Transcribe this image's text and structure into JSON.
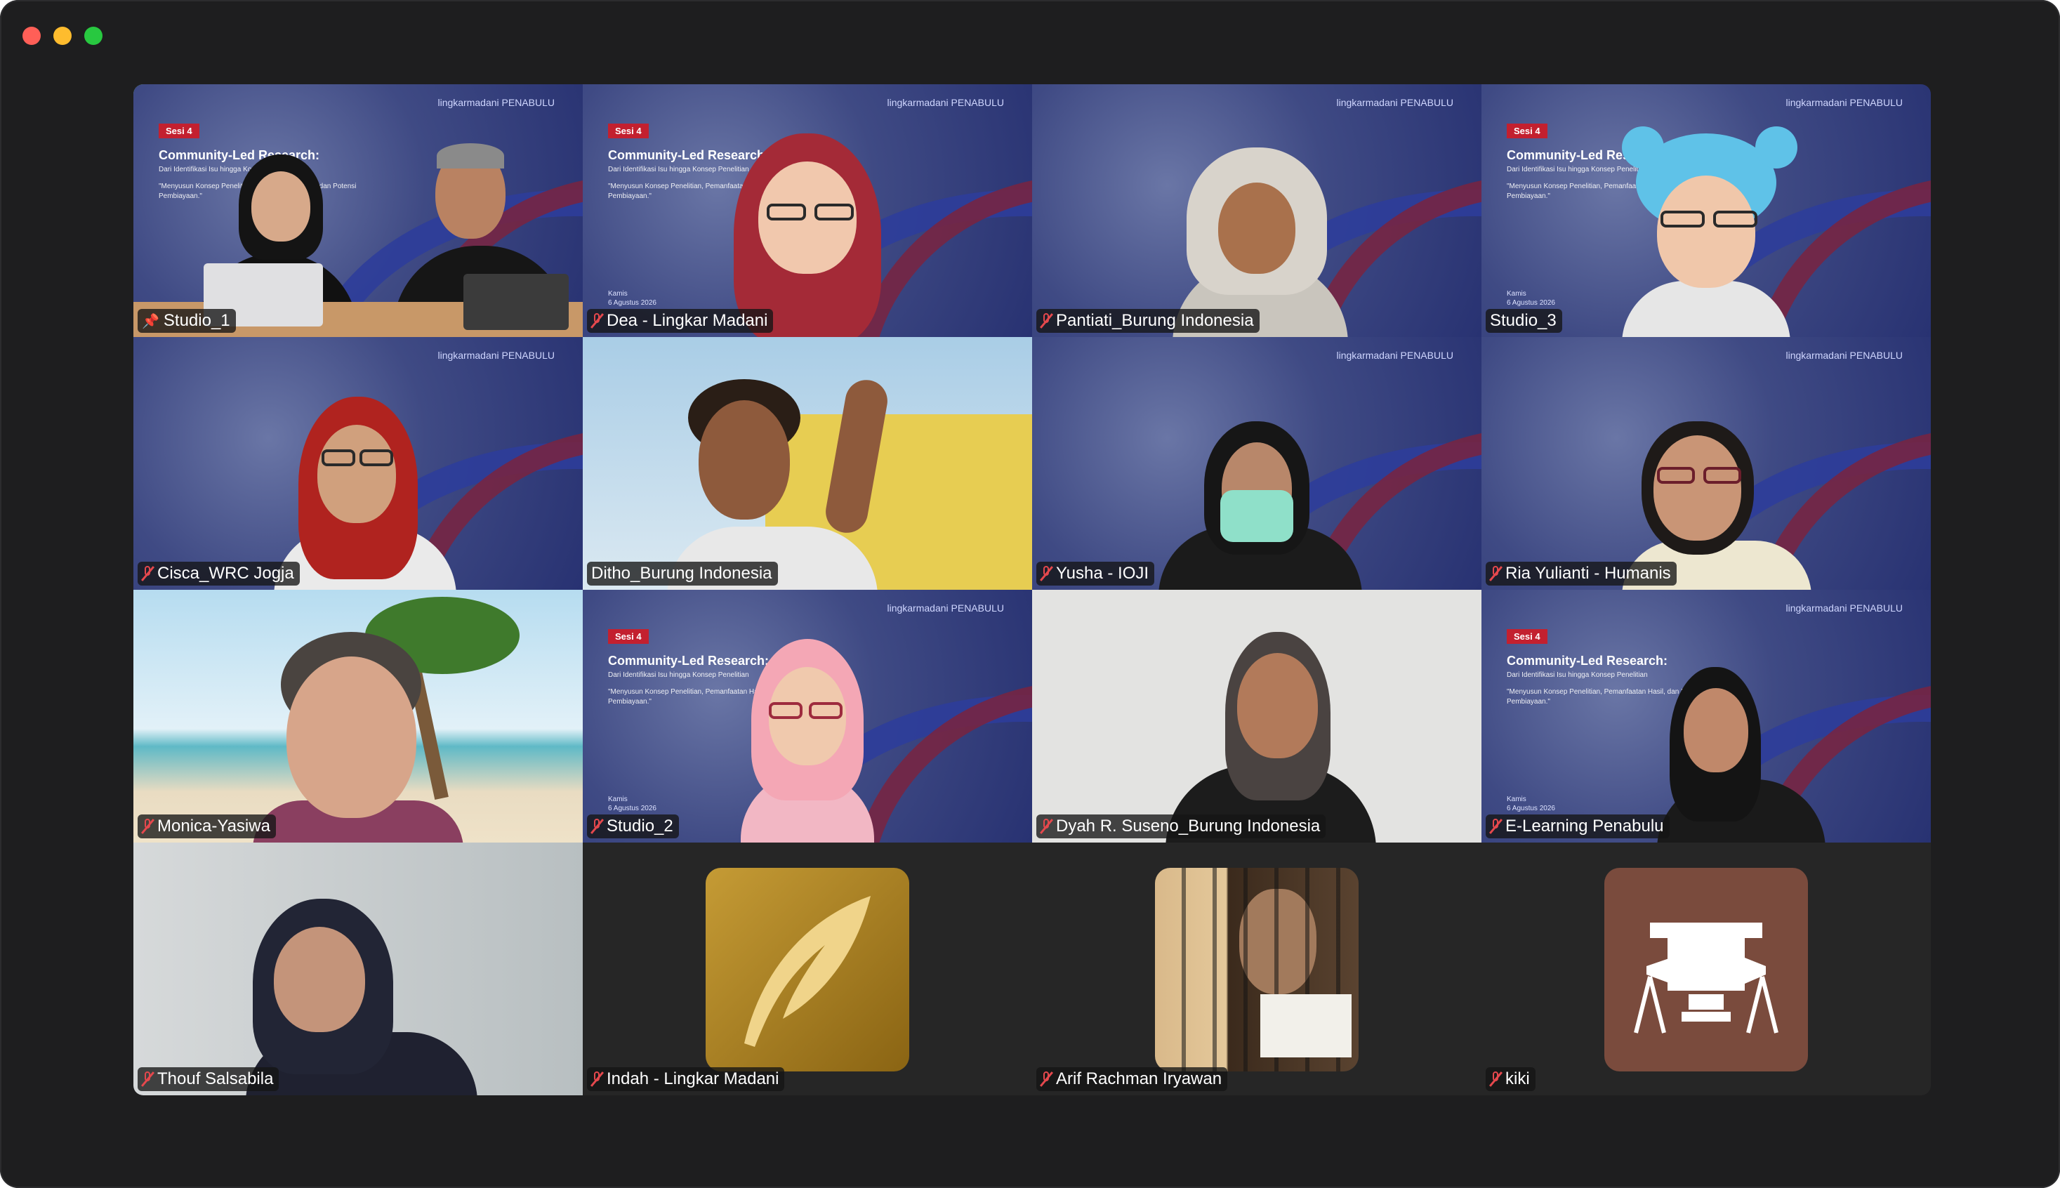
{
  "window": {
    "controls": {
      "close_color": "#ff5f57",
      "minimize_color": "#febc2e",
      "zoom_color": "#28c840"
    }
  },
  "slide": {
    "sesi": "Sesi 4",
    "title": "Community-Led Research:",
    "subtitle": "Dari Identifikasi Isu hingga Konsep Penelitian",
    "quote": "\"Menyusun Konsep Penelitian, Pemanfaatan Hasil, dan Potensi Pembiayaan.\"",
    "day": "Kamis",
    "date": "6 Agustus 2026",
    "logo": "lingkarmadani  PENABULU"
  },
  "participants": [
    {
      "name": "Studio_1",
      "status_icon": "pin-icon",
      "active": true
    },
    {
      "name": "Dea - Lingkar Madani",
      "status_icon": "mic-off-icon"
    },
    {
      "name": "Pantiati_Burung Indonesia",
      "status_icon": "mic-off-icon"
    },
    {
      "name": "Studio_3",
      "status_icon": "none"
    },
    {
      "name": "Cisca_WRC Jogja",
      "status_icon": "mic-off-icon"
    },
    {
      "name": "Ditho_Burung Indonesia",
      "status_icon": "none"
    },
    {
      "name": "Yusha - IOJI",
      "status_icon": "mic-off-icon"
    },
    {
      "name": "Ria Yulianti - Humanis",
      "status_icon": "mic-off-icon"
    },
    {
      "name": "Monica-Yasiwa",
      "status_icon": "mic-off-icon"
    },
    {
      "name": "Studio_2",
      "status_icon": "mic-off-icon"
    },
    {
      "name": "Dyah R. Suseno_Burung Indonesia",
      "status_icon": "mic-off-icon"
    },
    {
      "name": "E-Learning Penabulu",
      "status_icon": "mic-off-icon"
    },
    {
      "name": "Thouf Salsabila",
      "status_icon": "mic-off-icon"
    },
    {
      "name": "Indah - Lingkar Madani",
      "status_icon": "mic-off-icon"
    },
    {
      "name": "Arif Rachman Iryawan",
      "status_icon": "mic-off-icon"
    },
    {
      "name": "kiki",
      "status_icon": "mic-off-icon"
    }
  ]
}
